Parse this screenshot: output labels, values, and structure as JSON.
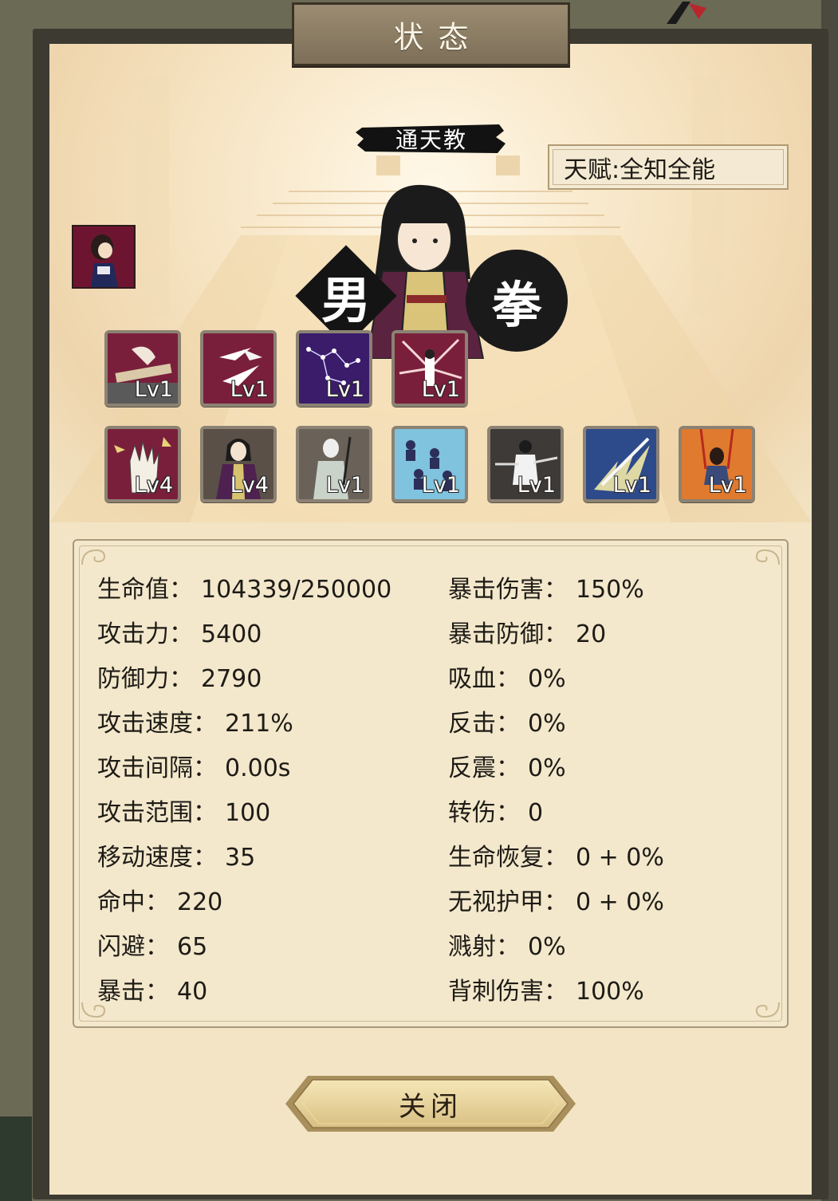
{
  "window_title": "状态",
  "sect": "通天教",
  "talent": "天赋:全知全能",
  "gender": "男",
  "weapon": "拳",
  "colors": {
    "panel": "#f2e4c4",
    "frame": "#3d3a32",
    "plank": "#8a7b63",
    "text": "#1e1b16"
  },
  "skills_row1": [
    {
      "icon": "guqin-hands-icon",
      "level": "Lv1"
    },
    {
      "icon": "flying-blades-icon",
      "level": "Lv1"
    },
    {
      "icon": "constellation-icon",
      "level": "Lv1"
    },
    {
      "icon": "burst-strike-icon",
      "level": "Lv1"
    }
  ],
  "skills_row2": [
    {
      "icon": "palm-strike-icon",
      "level": "Lv4"
    },
    {
      "icon": "robed-master-icon",
      "level": "Lv4"
    },
    {
      "icon": "swordsman-icon",
      "level": "Lv1"
    },
    {
      "icon": "shadow-clones-icon",
      "level": "Lv1"
    },
    {
      "icon": "dual-blades-icon",
      "level": "Lv1"
    },
    {
      "icon": "sword-flash-icon",
      "level": "Lv1"
    },
    {
      "icon": "swing-girl-icon",
      "level": "Lv1"
    }
  ],
  "stats_left": [
    {
      "label": "生命值：",
      "value": "104339/250000"
    },
    {
      "label": "攻击力：",
      "value": "5400"
    },
    {
      "label": "防御力：",
      "value": "2790"
    },
    {
      "label": "攻击速度：",
      "value": "211%"
    },
    {
      "label": "攻击间隔：",
      "value": "0.00s"
    },
    {
      "label": "攻击范围：",
      "value": "100"
    },
    {
      "label": "移动速度：",
      "value": "35"
    },
    {
      "label": "命中：",
      "value": "220"
    },
    {
      "label": "闪避：",
      "value": "65"
    },
    {
      "label": "暴击：",
      "value": "40"
    }
  ],
  "stats_right": [
    {
      "label": "暴击伤害：",
      "value": "150%"
    },
    {
      "label": "暴击防御：",
      "value": "20"
    },
    {
      "label": "吸血：",
      "value": "0%"
    },
    {
      "label": "反击：",
      "value": "0%"
    },
    {
      "label": "反震：",
      "value": "0%"
    },
    {
      "label": "转伤：",
      "value": "0"
    },
    {
      "label": "生命恢复：",
      "value": "0 + 0%"
    },
    {
      "label": "无视护甲：",
      "value": "0 + 0%"
    },
    {
      "label": "溅射：",
      "value": "0%"
    },
    {
      "label": "背刺伤害：",
      "value": "100%"
    }
  ],
  "close_label": "关闭"
}
